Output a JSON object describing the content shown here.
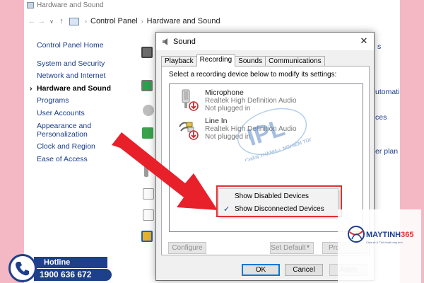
{
  "cp": {
    "title": "Hardware and Sound",
    "address": {
      "root": "Control Panel",
      "current": "Hardware and Sound"
    },
    "left_nav": {
      "home": "Control Panel Home",
      "items": [
        {
          "label": "System and Security"
        },
        {
          "label": "Network and Internet"
        },
        {
          "label": "Hardware and Sound",
          "active": true
        },
        {
          "label": "Programs"
        },
        {
          "label": "User Accounts"
        },
        {
          "label": "Appearance and"
        },
        {
          "label": "Personalization"
        },
        {
          "label": "Clock and Region"
        },
        {
          "label": "Ease of Access"
        }
      ]
    },
    "right_fragments": [
      "s",
      "utomati",
      "ces",
      "er plan"
    ]
  },
  "dialog": {
    "title": "Sound",
    "close_glyph": "✕",
    "tabs": [
      "Playback",
      "Recording",
      "Sounds",
      "Communications"
    ],
    "active_tab": "Recording",
    "instruction": "Select a recording device below to modify its settings:",
    "devices": [
      {
        "name": "Microphone",
        "driver": "Realtek High Definition Audio",
        "status": "Not plugged in",
        "icon": "microphone-icon"
      },
      {
        "name": "Line In",
        "driver": "Realtek High Definition Audio",
        "status": "Not plugged in",
        "icon": "line-in-icon"
      }
    ],
    "buttons": {
      "configure": "Configure",
      "set_default": "Set Default",
      "set_default_arrow": "▾",
      "properties": "Pro",
      "ok": "OK",
      "cancel": "Cancel",
      "apply": "Apply"
    }
  },
  "context_menu": {
    "items": [
      {
        "label": "Show Disabled Devices",
        "checked": false
      },
      {
        "label": "Show Disconnected Devices",
        "checked": true
      }
    ],
    "check_glyph": "✓"
  },
  "watermark": {
    "main": "IPL",
    "tagline_left": "CHÂN THÀNH",
    "tagline_mid": "VÀ",
    "tagline_right": "NGHIÊM TÚC"
  },
  "hotline": {
    "label": "Hotline",
    "number": "1900 636 672"
  },
  "brand": {
    "name": "MAYTINH",
    "number": "365",
    "sub": "Chia sẻ & Thủ thuật máy tính"
  },
  "colors": {
    "arrow": "#e8202a",
    "highlight": "#e03030",
    "link": "#1a3c8c",
    "hotline": "#1e3f8a",
    "background": "#f4b8c4"
  }
}
